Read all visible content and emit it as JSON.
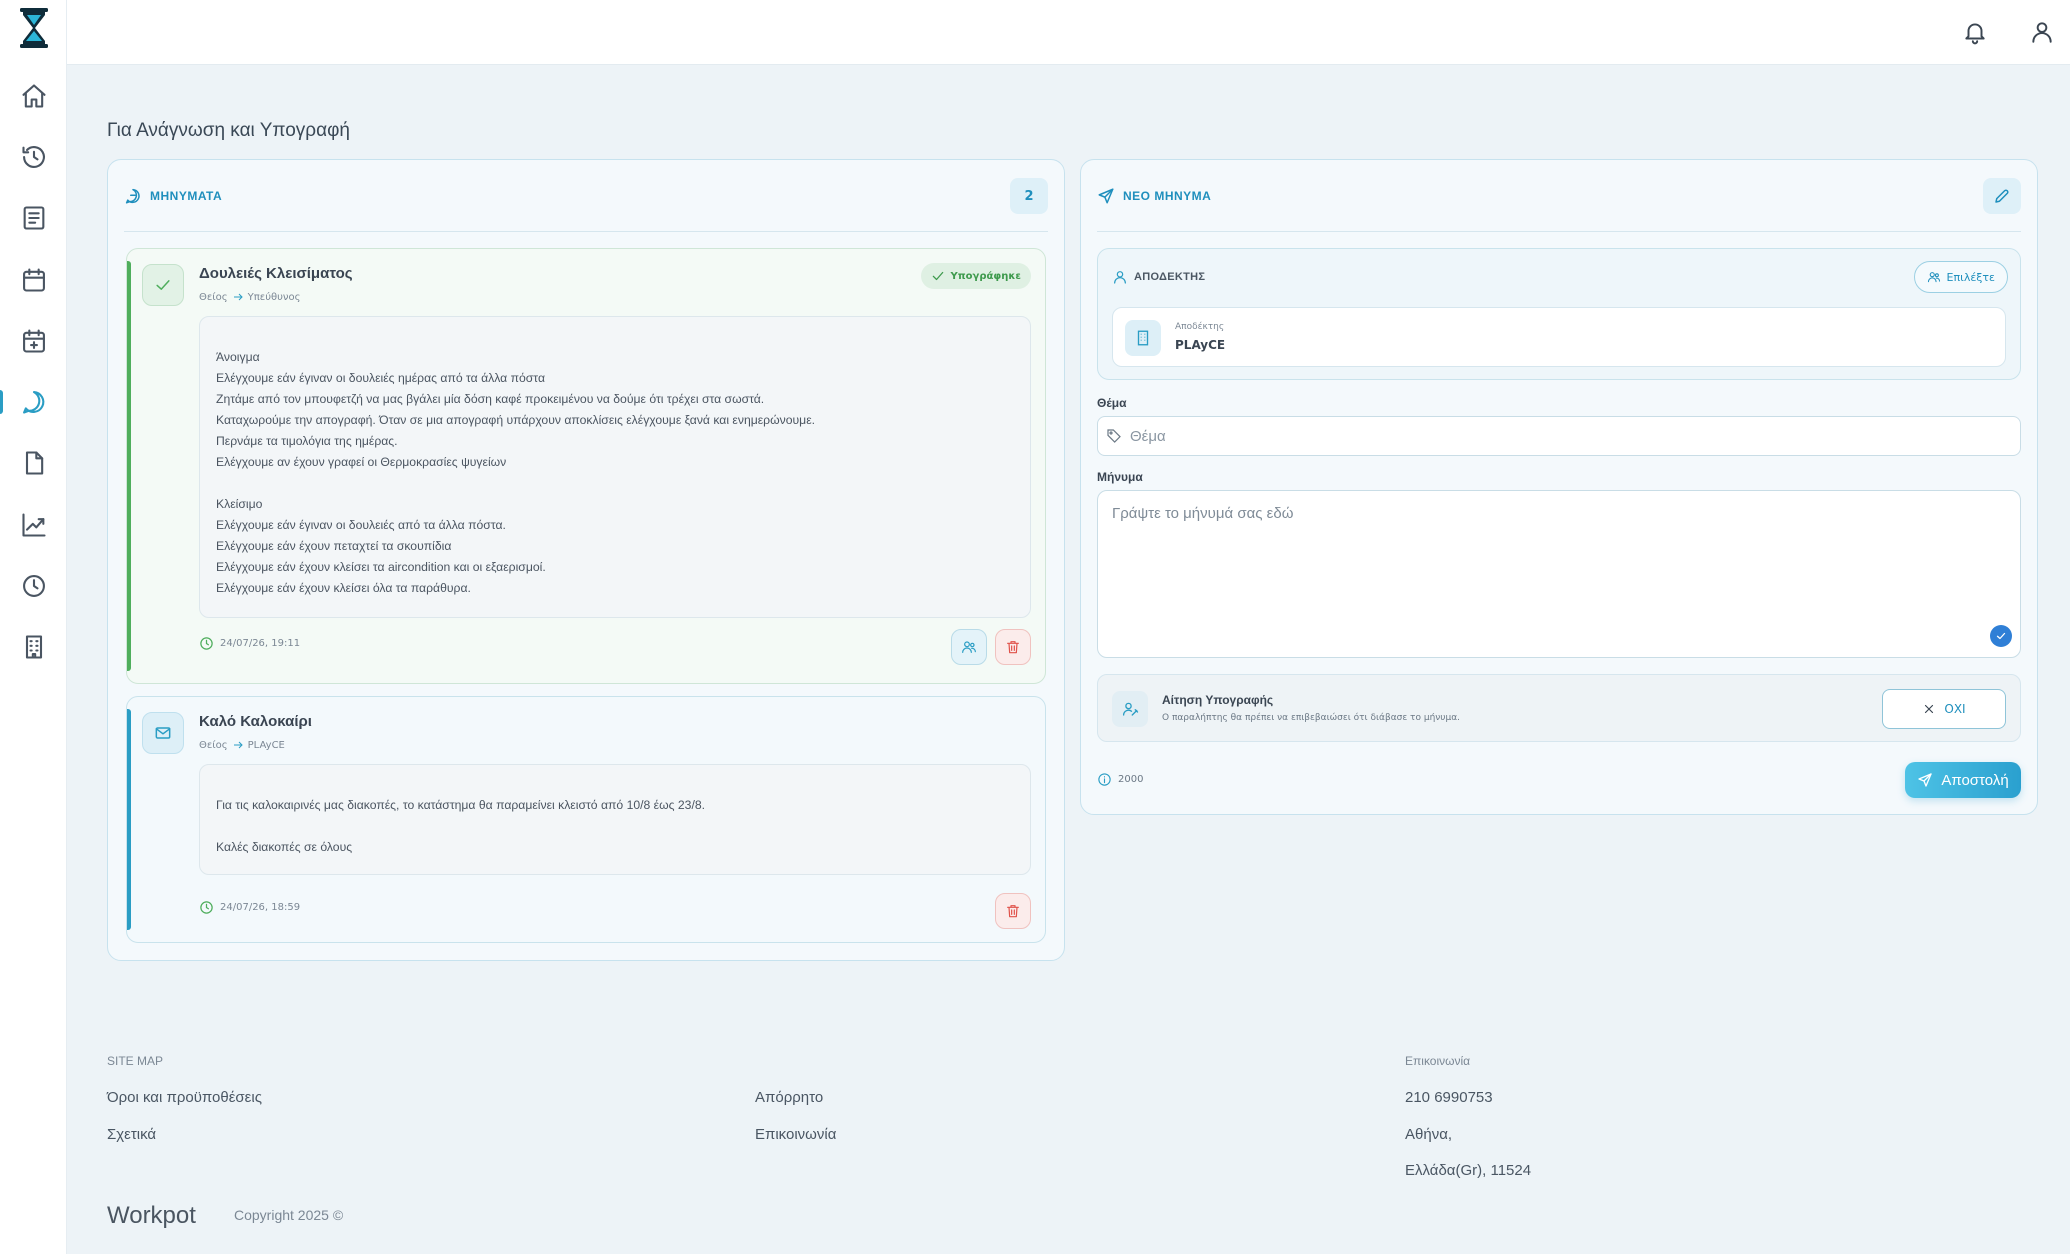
{
  "app": {
    "brand": "Workpot"
  },
  "sidebar": {
    "items": [
      {
        "icon": "home-icon"
      },
      {
        "icon": "history-icon"
      },
      {
        "icon": "document-icon"
      },
      {
        "icon": "calendar-icon"
      },
      {
        "icon": "calendar-add-icon"
      },
      {
        "icon": "chat-icon",
        "active": true
      },
      {
        "icon": "file-icon"
      },
      {
        "icon": "chart-icon"
      },
      {
        "icon": "clock-icon"
      },
      {
        "icon": "building-icon"
      }
    ]
  },
  "topbar": {
    "icons": [
      "bell-icon",
      "user-icon"
    ]
  },
  "page": {
    "title": "Για Ανάγνωση και Υπογραφή"
  },
  "messages_panel": {
    "title": "ΜΗΝΥΜΑΤΑ",
    "count": "2",
    "items": [
      {
        "title": "Δουλειές Κλεισίματος",
        "from": "Θείος",
        "to": "Υπεύθυνος",
        "status": "Υπογράφηκε",
        "lines": [
          "Άνοιγμα",
          "Ελέγχουμε εάν έγιναν οι δουλειές ημέρας από τα άλλα πόστα",
          "Ζητάμε από τον μπουφετζή να μας βγάλει μία δόση καφέ προκειμένου να δούμε ότι τρέχει στα σωστά.",
          "Καταχωρούμε την απογραφή. Όταν σε μια απογραφή υπάρχουν αποκλίσεις ελέγχουμε ξανά και ενημερώνουμε.",
          "Περνάμε τα τιμολόγια της ημέρας.",
          "Ελέγχουμε αν έχουν γραφεί οι Θερμοκρασίες ψυγείων",
          "",
          "Κλείσιμο",
          "Ελέγχουμε εάν έγιναν οι δουλειές από τα άλλα πόστα.",
          "Ελέγχουμε εάν έχουν πεταχτεί τα σκουπίδια",
          "Ελέγχουμε εάν έχουν κλείσει τα aircondition και οι εξαερισμοί.",
          "Ελέγχουμε εάν έχουν κλείσει όλα τα παράθυρα."
        ],
        "time": "24/07/26, 19:11"
      },
      {
        "title": "Καλό Καλοκαίρι",
        "from": "Θείος",
        "to": "PLAyCE",
        "lines": [
          "Για τις καλοκαιρινές μας διακοπές, το κατάστημα θα παραμείνει κλειστό από 10/8 έως 23/8.",
          "",
          "Καλές διακοπές σε όλους"
        ],
        "time": "24/07/26, 18:59"
      }
    ]
  },
  "new_message": {
    "title": "ΝΕΟ ΜΗΝΥΜΑ",
    "recipient_label": "ΑΠΟΔΕΚΤΗΣ",
    "select_label": "Επιλέξτε",
    "recipient_sub": "Αποδέκτης",
    "recipient_name": "PLAyCE",
    "subject_label": "Θέμα",
    "subject_placeholder": "Θέμα",
    "message_label": "Μήνυμα",
    "message_placeholder": "Γράψτε το μήνυμά σας εδώ",
    "sign_title": "Αίτηση Υπογραφής",
    "sign_desc": "Ο παραλήπτης θα πρέπει να επιβεβαιώσει ότι διάβασε το μήνυμα.",
    "sign_toggle_label": "ΟΧΙ",
    "char_count": "2000",
    "send_label": "Αποστολή"
  },
  "footer": {
    "sitemap_head": "SITE MAP",
    "links_col1": [
      "Όροι και προϋποθέσεις",
      "Σχετικά"
    ],
    "links_col2": [
      "Απόρρητο",
      "Επικοινωνία"
    ],
    "contact_head": "Επικοινωνία",
    "phone": "210 6990753",
    "city": "Αθήνα,",
    "country_zip": "Ελλάδα(Gr), 11524",
    "brand": "Workpot",
    "copyright": "Copyright 2025 ©"
  },
  "colors": {
    "accent": "#2a9dc4",
    "signed": "#4fae5d",
    "danger": "#e0524a",
    "background": "#edf3f7"
  }
}
